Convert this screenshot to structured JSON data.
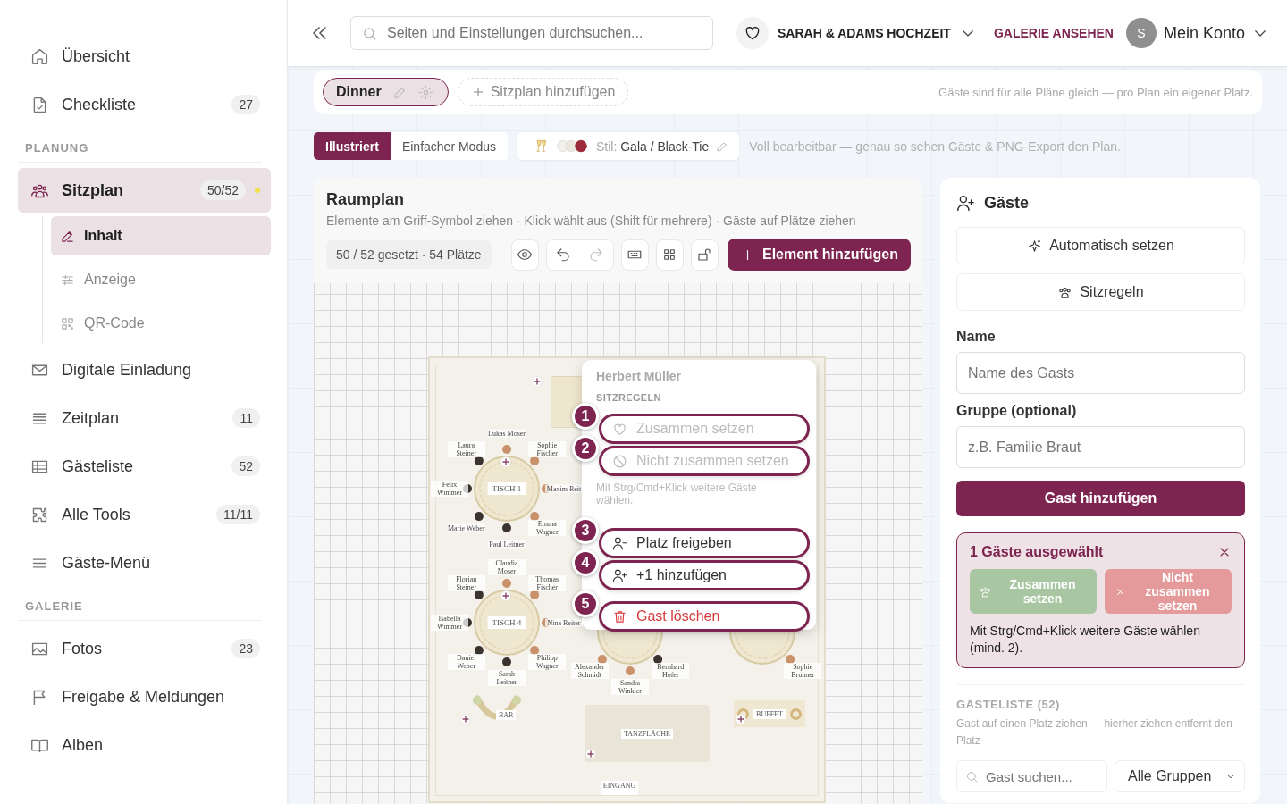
{
  "sidebar": [
    {
      "kind": "item",
      "label": "Übersicht",
      "selected": false,
      "notice": false
    },
    {
      "kind": "item",
      "label": "Checkliste",
      "count": "27",
      "selected": false,
      "notice": false
    },
    {
      "kind": "section",
      "label": "PLANUNG"
    },
    {
      "kind": "item",
      "label": "Sitzplan",
      "count": "50/52",
      "selected": true,
      "notice": true,
      "children": [
        {
          "label": "Inhalt",
          "selected": true
        },
        {
          "label": "Anzeige",
          "selected": false
        },
        {
          "label": "QR-Code",
          "selected": false
        }
      ]
    },
    {
      "kind": "item",
      "label": "Digitale Einladung",
      "selected": false,
      "notice": false
    },
    {
      "kind": "item",
      "label": "Zeitplan",
      "count": "11",
      "selected": false,
      "notice": false
    },
    {
      "kind": "item",
      "label": "Gästeliste",
      "count": "52",
      "selected": false,
      "notice": false
    },
    {
      "kind": "item",
      "label": "Alle Tools",
      "count": "11/11",
      "selected": false,
      "notice": false
    },
    {
      "kind": "item",
      "label": "Gäste-Menü",
      "selected": false,
      "notice": false
    },
    {
      "kind": "section",
      "label": "GALERIE"
    },
    {
      "kind": "item",
      "label": "Fotos",
      "count": "23",
      "selected": false,
      "notice": false
    },
    {
      "kind": "item",
      "label": "Freigabe & Meldungen",
      "selected": false,
      "notice": false
    },
    {
      "kind": "item",
      "label": "Alben",
      "selected": false,
      "notice": false
    }
  ],
  "header": {
    "search": {
      "placeholder": "Seiten und Einstellungen durchsuchen..."
    },
    "event": "SARAH & ADAMS HOCHZEIT",
    "gallery_link": "GALERIE ANSEHEN",
    "avatar": "S",
    "account": "Mein Konto"
  },
  "plans": {
    "tabs": [
      {
        "label": "Dinner",
        "selected": true
      }
    ],
    "add": "Sitzplan hinzufügen",
    "note": "Gäste sind für alle Pläne gleich — pro Plan ein eigener Platz."
  },
  "modes": {
    "tabs": [
      {
        "label": "Illustriert",
        "selected": true
      },
      {
        "label": "Einfacher Modus",
        "selected": false
      }
    ],
    "style_prefix": "Stil:",
    "style_value": "Gala / Black-Tie",
    "note": "Voll bearbeitbar — genau so sehen Gäste & PNG-Export den Plan."
  },
  "room": {
    "title": "Raumplan",
    "hint": "Elemente am Griff-Symbol ziehen · Klick wählt aus (Shift für mehrere) · Gäste auf Plätze ziehen",
    "stats": "50 / 52 gesetzt · 54 Plätze",
    "add": "Element hinzufügen",
    "tables": [
      {
        "label": "TISCH 1",
        "seats": [
          "Lukas Moser",
          "Laura Steiner",
          "Sophie Fischer",
          "Felix Wimmer",
          "Maxim Reit",
          "Marie Weber",
          "Emma Wagner",
          "Paul Leitner"
        ]
      },
      {
        "label": "TISCH 4",
        "seats": [
          "Claudia Moser",
          "Florian Steiner",
          "Thomas Fischer",
          "Isabella Wimmer",
          "Nina Reiter",
          "Daniel Weber",
          "Philipp Wagner",
          "Sarah Leitner"
        ]
      },
      {
        "seats": [
          "Alexander Schmidt",
          "Bernhard Hofer",
          "Sandra Winkler"
        ]
      },
      {
        "seats": [
          "Sophie Brunner"
        ]
      }
    ],
    "areas": [
      {
        "kind": "bar",
        "label": "BAR"
      },
      {
        "kind": "dance",
        "label": "TANZFLÄCHE"
      },
      {
        "kind": "buffet",
        "label": "BUFFET"
      },
      {
        "kind": "entrance",
        "label": "EINGANG"
      }
    ],
    "menu": {
      "guest": "Herbert Müller",
      "section": "SITZREGELN",
      "hint": "Mit Strg/Cmd+Klick weitere Gäste wählen.",
      "actions": [
        {
          "kind": "rule",
          "step": "1",
          "label": "Zusammen setzen",
          "disabled": true
        },
        {
          "kind": "rule",
          "step": "2",
          "label": "Nicht zusammen setzen",
          "disabled": true
        },
        {
          "kind": "free",
          "step": "3",
          "label": "Platz freigeben",
          "disabled": false
        },
        {
          "kind": "plusone",
          "step": "4",
          "label": "+1 hinzufügen",
          "disabled": false
        },
        {
          "kind": "delete",
          "step": "5",
          "label": "Gast löschen",
          "disabled": false
        }
      ]
    }
  },
  "guests": {
    "title": "Gäste",
    "auto": "Automatisch setzen",
    "rules": "Sitzregeln",
    "name_label": "Name",
    "name_placeholder": "Name des Gasts",
    "group_label": "Gruppe (optional)",
    "group_placeholder": "z.B. Familie Braut",
    "add": "Gast hinzufügen",
    "selection": {
      "title": "1 Gäste ausgewählt",
      "together": "Zusammen setzen",
      "apart": "Nicht zusammen setzen",
      "hint": "Mit Strg/Cmd+Klick weitere Gäste wählen (mind. 2)."
    },
    "list": {
      "title": "GÄSTELISTE (52)",
      "hint": "Gast auf einen Platz ziehen — hierher ziehen entfernt den Platz",
      "search_placeholder": "Gast suchen...",
      "group_filter": "Alle Gruppen"
    }
  }
}
